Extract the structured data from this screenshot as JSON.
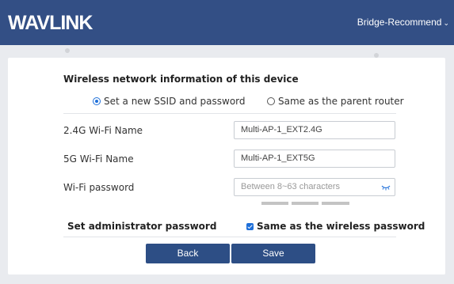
{
  "header": {
    "logo_text": "WAVLINK",
    "mode_label": "Bridge-Recommend",
    "mode_chevron": "⌄"
  },
  "form": {
    "title": "Wireless network information of this device",
    "radio_new": "Set a new SSID and password",
    "radio_same": "Same as the parent router",
    "wifi24_label": "2.4G Wi-Fi Name",
    "wifi24_value": "Multi-AP-1_EXT2.4G",
    "wifi5_label": "5G Wi-Fi Name",
    "wifi5_value": "Multi-AP-1_EXT5G",
    "password_label": "Wi-Fi password",
    "password_placeholder": "Between 8~63 characters",
    "admin_label": "Set administrator password",
    "admin_same_label": "Same as the wireless password",
    "back_label": "Back",
    "save_label": "Save"
  },
  "state": {
    "selected_radio": "radio_new",
    "admin_same_checked": true
  },
  "colors": {
    "header_bg": "#334f85",
    "button_bg": "#2d4e85",
    "accent": "#1e6fd9",
    "strength_bar": "#c4c4c4"
  },
  "icons": {
    "eye": "eye-closed-icon",
    "chevron": "chevron-down-icon",
    "radio_on": "radio-selected-icon",
    "radio_off": "radio-unselected-icon",
    "checkbox": "checkbox-checked-icon"
  }
}
